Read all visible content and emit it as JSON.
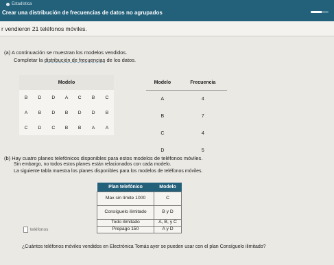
{
  "header": {
    "subtitle": "Estadística",
    "title": "Crear una distribución de frecuencias de datos no agrupados",
    "progress_fraction": 0.6
  },
  "problem": {
    "statement": "r vendieron 21 teléfonos móviles."
  },
  "part_a": {
    "label": "(a) A continuación se muestran los modelos vendidos.",
    "instruction_prefix": "Completar la ",
    "instruction_link": "distribución de frecuencias",
    "instruction_suffix": " de los datos."
  },
  "models_table": {
    "header": "Modelo",
    "rows": [
      [
        "B",
        "D",
        "D",
        "A",
        "C",
        "B",
        "C"
      ],
      [
        "A",
        "B",
        "D",
        "B",
        "D",
        "D",
        "B"
      ],
      [
        "C",
        "D",
        "C",
        "B",
        "B",
        "A",
        "A"
      ]
    ]
  },
  "freq_table": {
    "col1": "Modelo",
    "col2": "Frecuencia",
    "rows": [
      {
        "model": "A",
        "freq": "4"
      },
      {
        "model": "B",
        "freq": "7"
      },
      {
        "model": "C",
        "freq": "4"
      },
      {
        "model": "D",
        "freq": "5"
      }
    ]
  },
  "part_b": {
    "label": "(b) Hay cuatro planes telefónicos disponibles para estos modelos de teléfonos móviles.",
    "line2": "Sin embargo, no todos estos planes están relacionados con cada modelo.",
    "line3": "La siguiente tabla muestra los planes disponibles para los modelos de teléfonos móviles."
  },
  "plans_table": {
    "col1": "Plan telefónico",
    "col2": "Modelo",
    "rows": [
      {
        "plan": "Max sin límite 1000",
        "model": "C"
      },
      {
        "plan": "Consíguelo ilimitado",
        "model": "B y D"
      },
      {
        "plan": "Todo ilimitado",
        "model": "A, B, y C"
      },
      {
        "plan": "Prepago 150",
        "model": "A y D"
      }
    ]
  },
  "question": "¿Cuántos teléfonos móviles vendidos en Electrónica Tomás ayer se pueden usar con el plan Consíguelo ilimitado?",
  "answer": {
    "unit": "teléfonos"
  }
}
